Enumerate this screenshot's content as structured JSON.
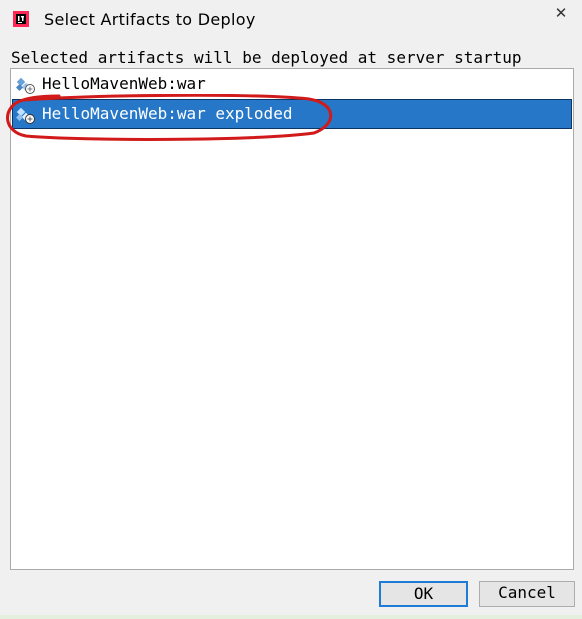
{
  "window": {
    "title": "Select Artifacts to Deploy",
    "app_icon": "intellij-idea-icon",
    "close_glyph": "✕"
  },
  "description": "Selected artifacts will be deployed at server startup",
  "artifacts": [
    {
      "label": "HelloMavenWeb:war",
      "icon": "web-artifact-icon",
      "selected": false
    },
    {
      "label": "HelloMavenWeb:war exploded",
      "icon": "web-artifact-icon",
      "selected": true
    }
  ],
  "buttons": {
    "ok": "OK",
    "cancel": "Cancel"
  },
  "colors": {
    "selection": "#2677c8",
    "annotation": "#d11a1a",
    "default_button_border": "#1e7bd7"
  }
}
